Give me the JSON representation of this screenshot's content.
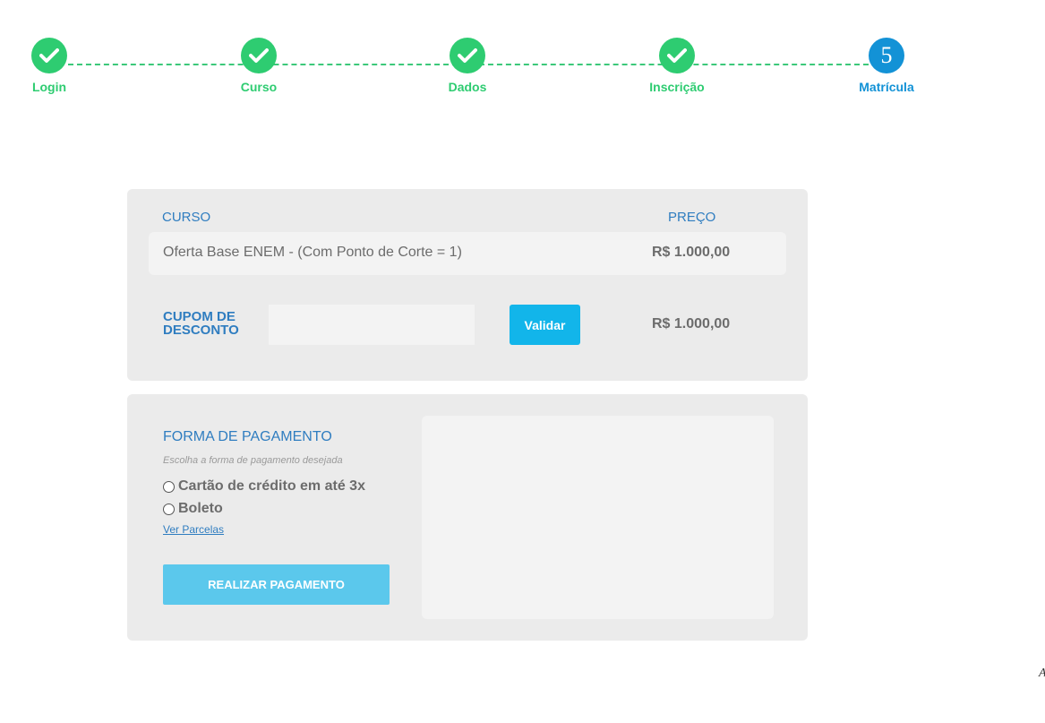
{
  "stepper": {
    "steps": [
      {
        "label": "Login",
        "state": "done",
        "icon": "check-icon"
      },
      {
        "label": "Curso",
        "state": "done",
        "icon": "check-icon"
      },
      {
        "label": "Dados",
        "state": "done",
        "icon": "check-icon"
      },
      {
        "label": "Inscrição",
        "state": "done",
        "icon": "check-icon"
      },
      {
        "label": "Matrícula",
        "state": "active",
        "number": "5"
      }
    ],
    "done_color": "#2ecc71",
    "active_color": "#1392d6"
  },
  "course_panel": {
    "course_header": "CURSO",
    "price_header": "PREÇO",
    "course_name": "Oferta Base ENEM - (Com Ponto de Corte = 1)",
    "course_price": "R$ 1.000,00",
    "coupon_label_line1": "CUPOM DE",
    "coupon_label_line2": "DESCONTO",
    "coupon_value": "",
    "validate_label": "Validar",
    "total_price": "R$ 1.000,00"
  },
  "payment_panel": {
    "title": "FORMA DE PAGAMENTO",
    "hint": "Escolha a forma de pagamento desejada",
    "options": [
      "Cartão de crédito em até 3x",
      "Boleto"
    ],
    "installments_link": "Ver Parcelas",
    "pay_button": "REALIZAR PAGAMENTO"
  },
  "corner_glyph": "A"
}
